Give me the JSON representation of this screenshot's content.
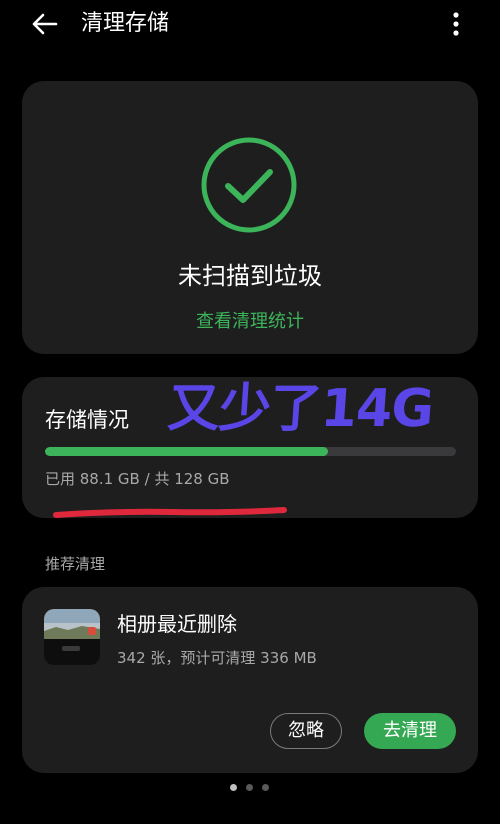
{
  "header": {
    "title": "清理存储",
    "back_icon": "arrow-left-icon",
    "more_icon": "more-vertical-icon"
  },
  "status_card": {
    "icon": "check-circle-icon",
    "status_text": "未扫描到垃圾",
    "stats_link": "查看清理统计",
    "accent_color": "#3cb45a"
  },
  "storage": {
    "title": "存储情况",
    "annotation": "又少了14G",
    "usage_text": "已用 88.1 GB / 共 128 GB",
    "used_gb": 88.1,
    "total_gb": 128,
    "bar_color": "#3cb45a",
    "annotation_color": "#5a46e6",
    "underline_color": "#e0283c"
  },
  "recommendations": {
    "section_label": "推荐清理",
    "items": [
      {
        "title": "相册最近删除",
        "subtitle": "342 张，预计可清理 336 MB",
        "ignore_label": "忽略",
        "clean_label": "去清理"
      }
    ]
  },
  "pager": {
    "count": 3,
    "active_index": 0
  }
}
